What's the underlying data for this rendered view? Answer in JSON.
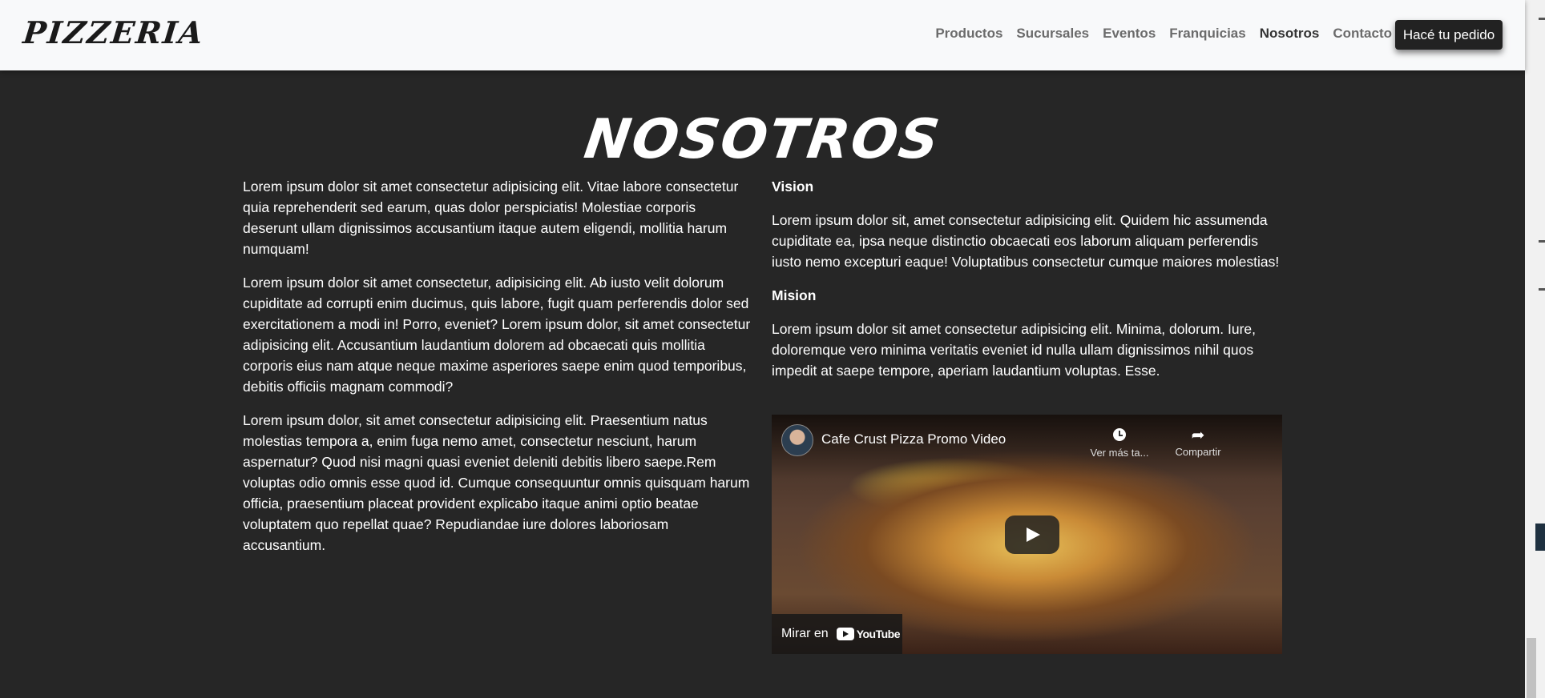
{
  "navbar": {
    "brand": "Pizzeria",
    "links": [
      {
        "label": "Productos"
      },
      {
        "label": "Sucursales"
      },
      {
        "label": "Eventos"
      },
      {
        "label": "Franquicias"
      },
      {
        "label": "Nosotros",
        "active": true
      },
      {
        "label": "Contacto",
        "dropdown": true
      }
    ],
    "cta": "Hacé tu pedido"
  },
  "page": {
    "title": "Nosotros",
    "left_paragraphs": [
      "Lorem ipsum dolor sit amet consectetur adipisicing elit. Vitae labore consectetur quia reprehenderit sed earum, quas dolor perspiciatis! Molestiae corporis deserunt ullam dignissimos accusantium itaque autem eligendi, mollitia harum numquam!",
      "Lorem ipsum dolor sit amet consectetur, adipisicing elit. Ab iusto velit dolorum cupiditate ad corrupti enim ducimus, quis labore, fugit quam perferendis dolor sed exercitationem a modi in! Porro, eveniet? Lorem ipsum dolor, sit amet consectetur adipisicing elit. Accusantium laudantium dolorem ad obcaecati quis mollitia corporis eius nam atque neque maxime asperiores saepe enim quod temporibus, debitis officiis magnam commodi?",
      "Lorem ipsum dolor, sit amet consectetur adipisicing elit. Praesentium natus molestias tempora a, enim fuga nemo amet, consectetur nesciunt, harum aspernatur? Quod nisi magni quasi eveniet deleniti debitis libero saepe.Rem voluptas odio omnis esse quod id. Cumque consequuntur omnis quisquam harum officia, praesentium placeat provident explicabo itaque animi optio beatae voluptatem quo repellat quae? Repudiandae iure dolores laboriosam accusantium."
    ],
    "vision": {
      "heading": "Vision",
      "text": "Lorem ipsum dolor sit, amet consectetur adipisicing elit. Quidem hic assumenda cupiditate ea, ipsa neque distinctio obcaecati eos laborum aliquam perferendis iusto nemo excepturi eaque! Voluptatibus consectetur cumque maiores molestias!"
    },
    "mision": {
      "heading": "Mision",
      "text": "Lorem ipsum dolor sit amet consectetur adipisicing elit. Minima, dolorum. Iure, doloremque vero minima veritatis eveniet id nulla ullam dignissimos nihil quos impedit at saepe tempore, aperiam laudantium voluptas. Esse."
    },
    "video": {
      "title": "Cafe Crust Pizza Promo Video",
      "watch_later": "Ver más ta...",
      "share": "Compartir",
      "watch_on": "Mirar en",
      "youtube": "YouTube",
      "icons": [
        "clock-icon",
        "share-icon",
        "play-icon",
        "youtube-logo-icon"
      ]
    }
  }
}
